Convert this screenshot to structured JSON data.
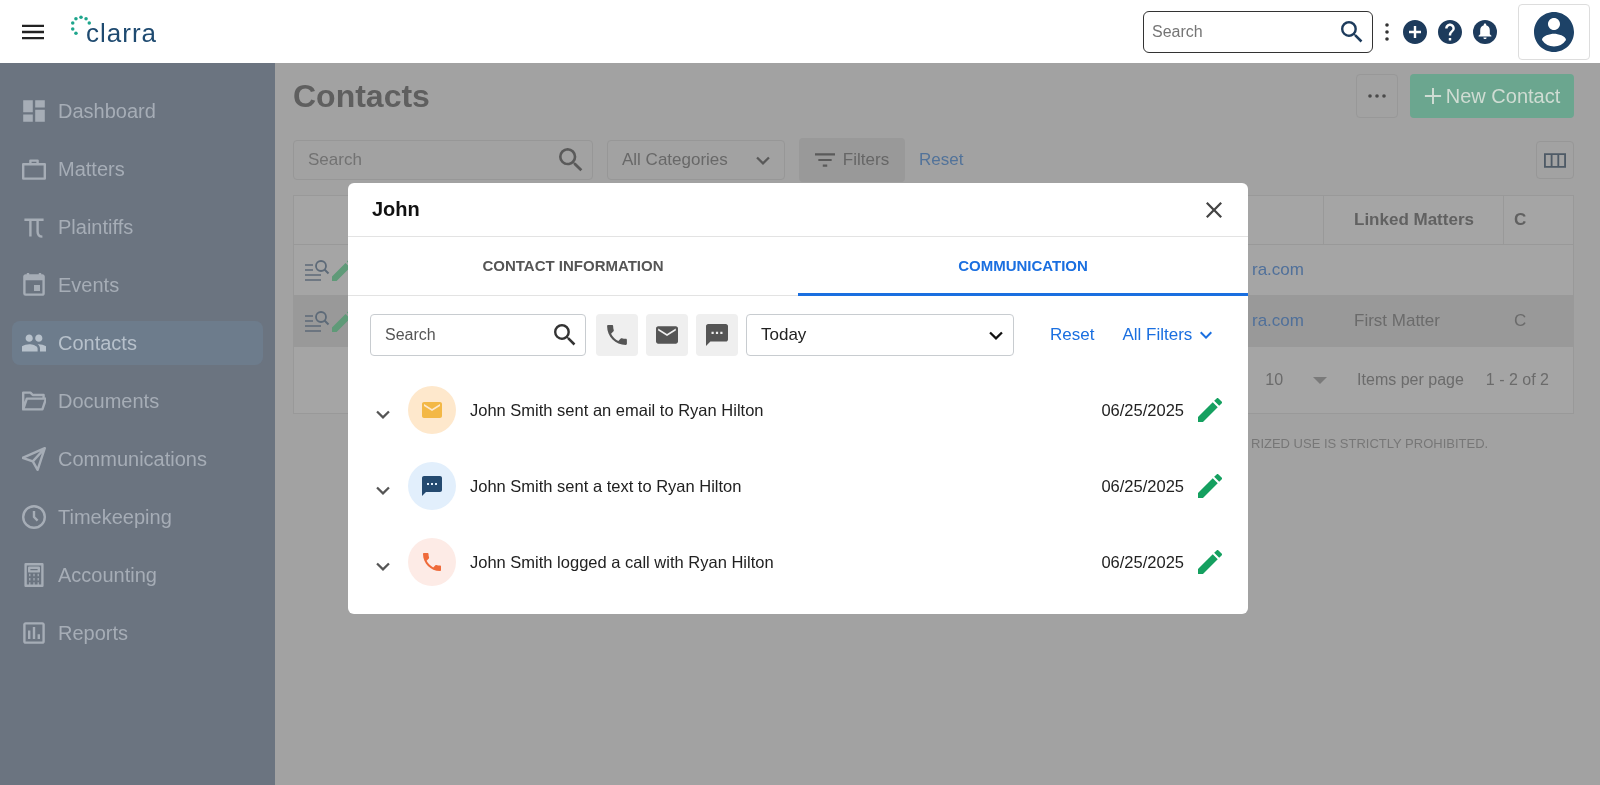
{
  "header": {
    "logo": "clarra",
    "search": {
      "placeholder": "Search"
    }
  },
  "sidebar": {
    "items": [
      {
        "label": "Dashboard",
        "selected": false
      },
      {
        "label": "Matters",
        "selected": false
      },
      {
        "label": "Plaintiffs",
        "selected": false
      },
      {
        "label": "Events",
        "selected": false
      },
      {
        "label": "Contacts",
        "selected": true
      },
      {
        "label": "Documents",
        "selected": false
      },
      {
        "label": "Communications",
        "selected": false
      },
      {
        "label": "Timekeeping",
        "selected": false
      },
      {
        "label": "Accounting",
        "selected": false
      },
      {
        "label": "Reports",
        "selected": false
      }
    ]
  },
  "page": {
    "title": "Contacts",
    "search": {
      "placeholder": "Search"
    },
    "category": "All Categories",
    "filters_button": "Filters",
    "reset": "Reset",
    "new_contact": "New Contact",
    "table": {
      "columns": [
        "Linked Matters",
        "C"
      ],
      "rows": [
        {
          "email": "ra.com",
          "selected": false
        },
        {
          "email": "ra.com",
          "linked_matters": "First Matter",
          "column_3": "C",
          "selected": true
        }
      ],
      "pagination": {
        "per_page": "10",
        "label": "Items per page",
        "range": "1 - 2 of 2"
      }
    },
    "notice": "RIZED USE IS STRICTLY PROHIBITED."
  },
  "modal": {
    "title": "John",
    "tabs": [
      {
        "label": "CONTACT INFORMATION",
        "selected": false
      },
      {
        "label": "COMMUNICATION",
        "selected": true
      }
    ],
    "search": {
      "placeholder": "Search"
    },
    "type_filters": [
      {
        "kind": "call"
      },
      {
        "kind": "email"
      },
      {
        "kind": "text"
      }
    ],
    "period": "Today",
    "reset": "Reset",
    "all_filters": "All Filters",
    "items": [
      {
        "kind": "email",
        "color": "#fee8cc",
        "text": "John Smith sent an email to Ryan Hilton",
        "date": "06/25/2025"
      },
      {
        "kind": "text",
        "color": "#e2effc",
        "text": "John Smith sent a text to Ryan Hilton",
        "date": "06/25/2025"
      },
      {
        "kind": "call",
        "color": "#fdebe6",
        "text": "John Smith logged a call with Ryan Hilton",
        "date": "06/25/2025"
      }
    ]
  }
}
